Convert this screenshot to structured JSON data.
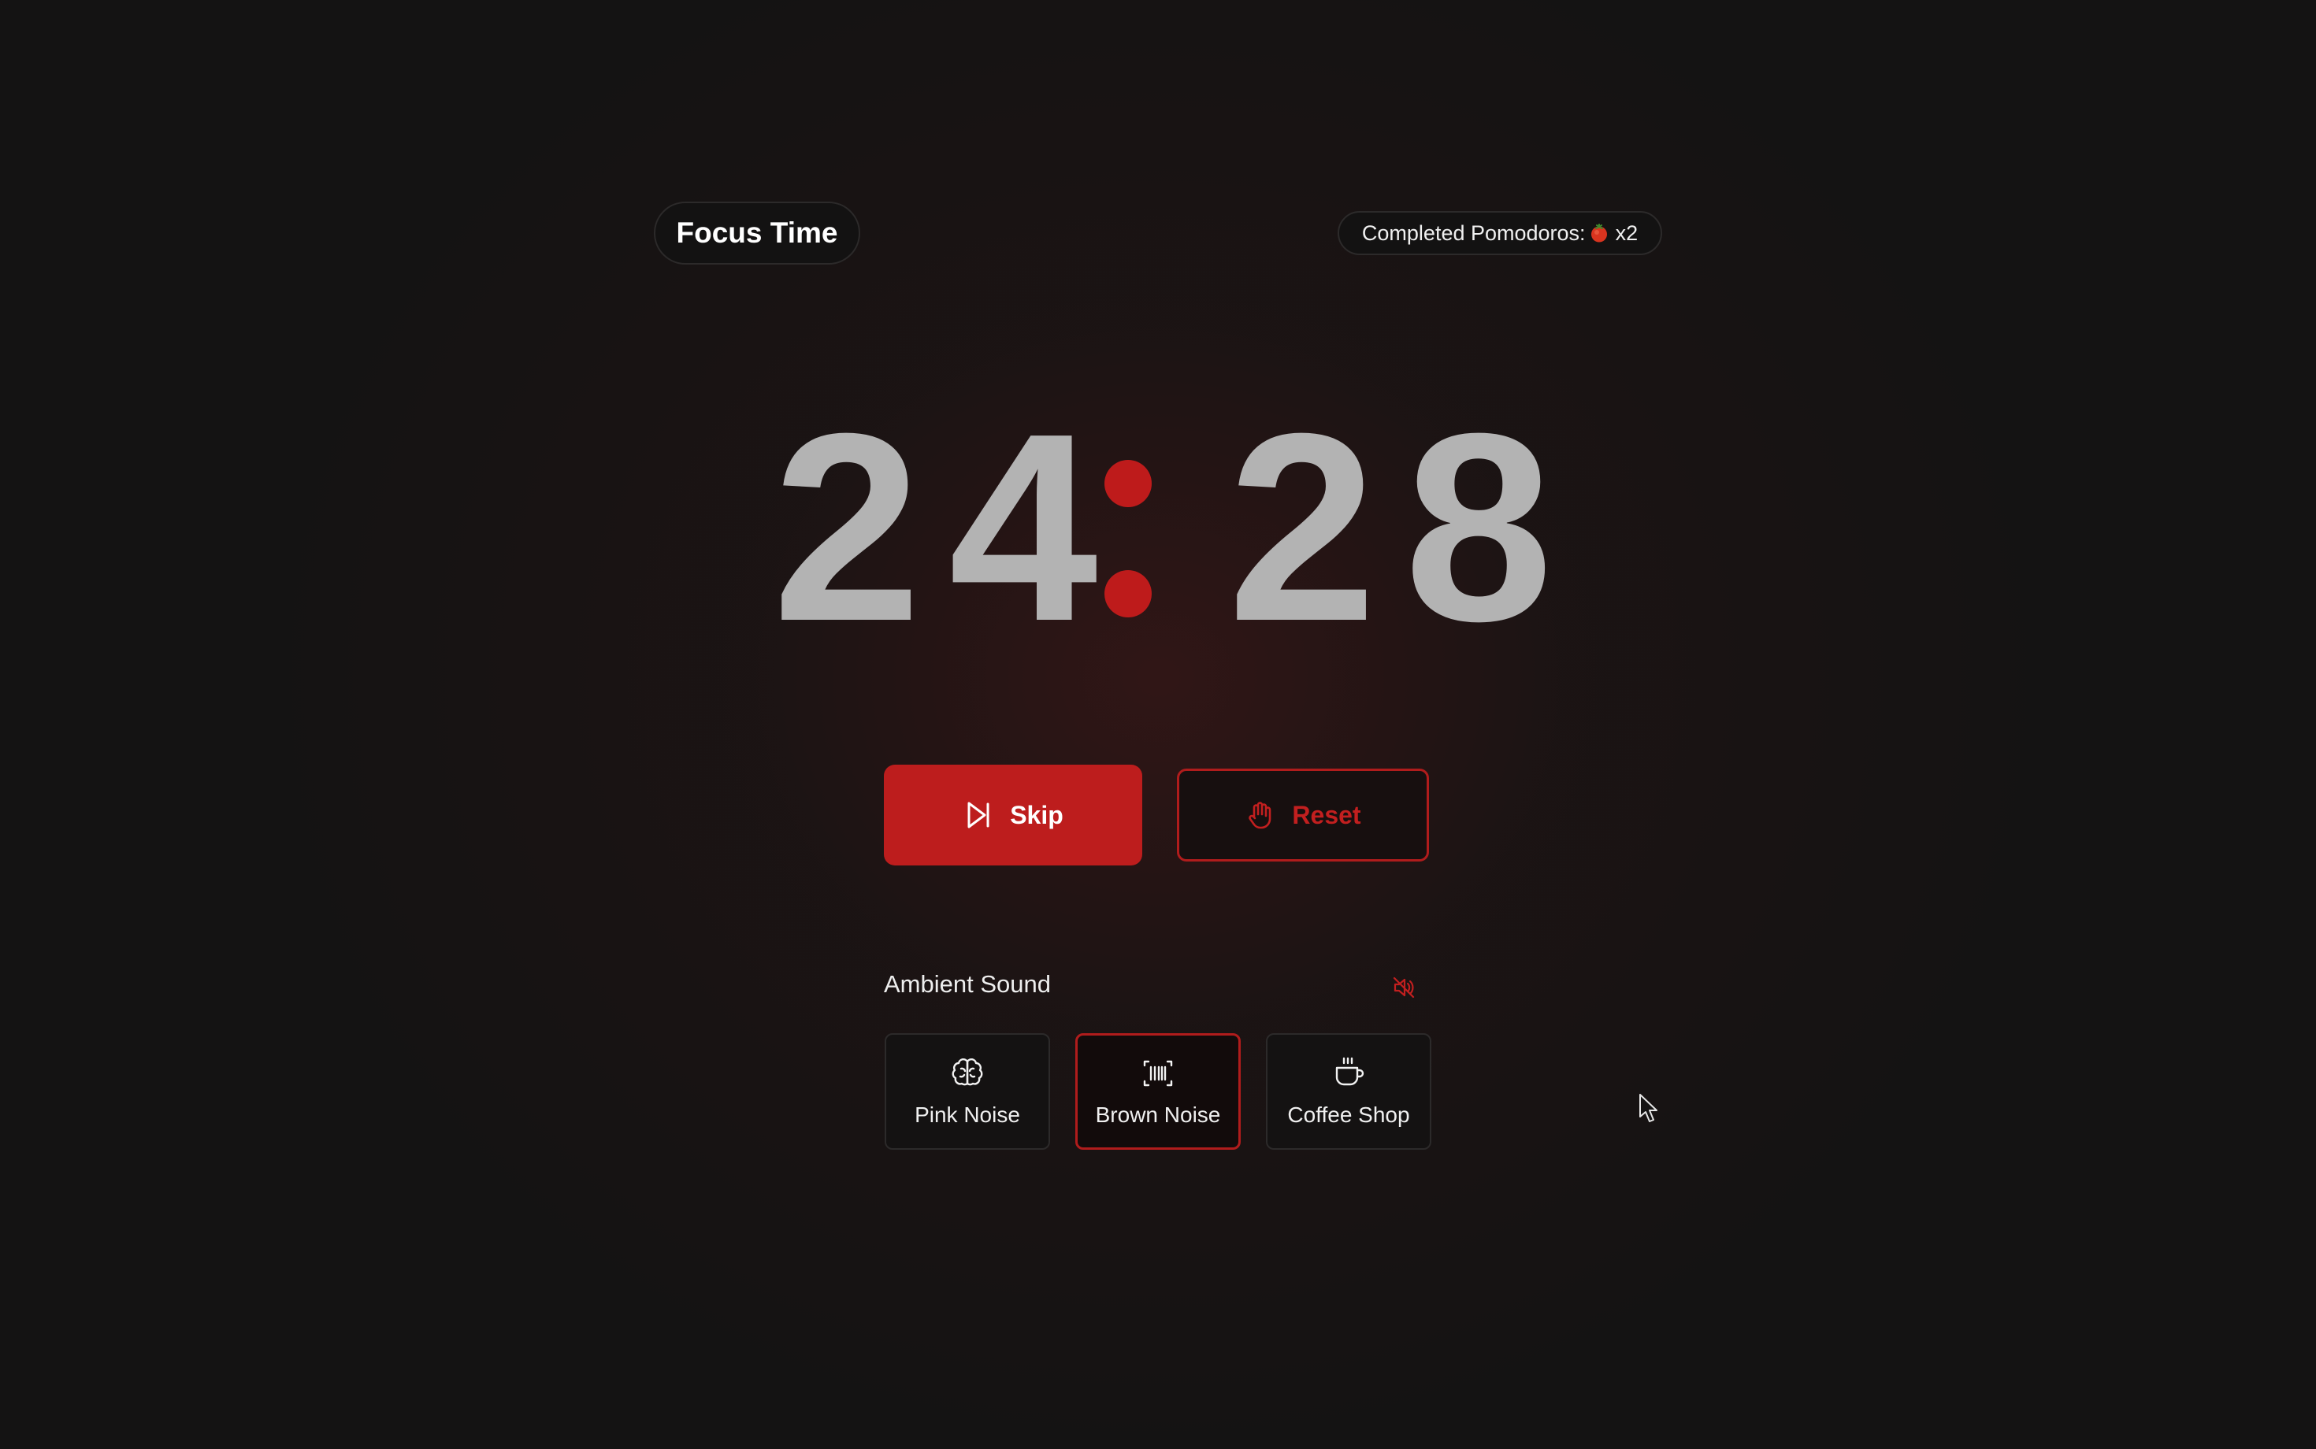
{
  "header": {
    "title": "Focus Time",
    "pomodoros_label": "Completed Pomodoros:",
    "pomodoros_count": "x2"
  },
  "timer": {
    "minutes_tens": "2",
    "minutes_ones": "4",
    "seconds_tens": "2",
    "seconds_ones": "8"
  },
  "controls": {
    "skip_label": "Skip",
    "reset_label": "Reset"
  },
  "ambient": {
    "label": "Ambient Sound",
    "options": [
      {
        "label": "Pink Noise",
        "icon": "brain-icon",
        "selected": false
      },
      {
        "label": "Brown Noise",
        "icon": "barcode-icon",
        "selected": true
      },
      {
        "label": "Coffee Shop",
        "icon": "coffee-cup-icon",
        "selected": false
      }
    ]
  },
  "colors": {
    "accent": "#be1b1b",
    "background": "#141313",
    "digit": "#b3b3b3"
  }
}
